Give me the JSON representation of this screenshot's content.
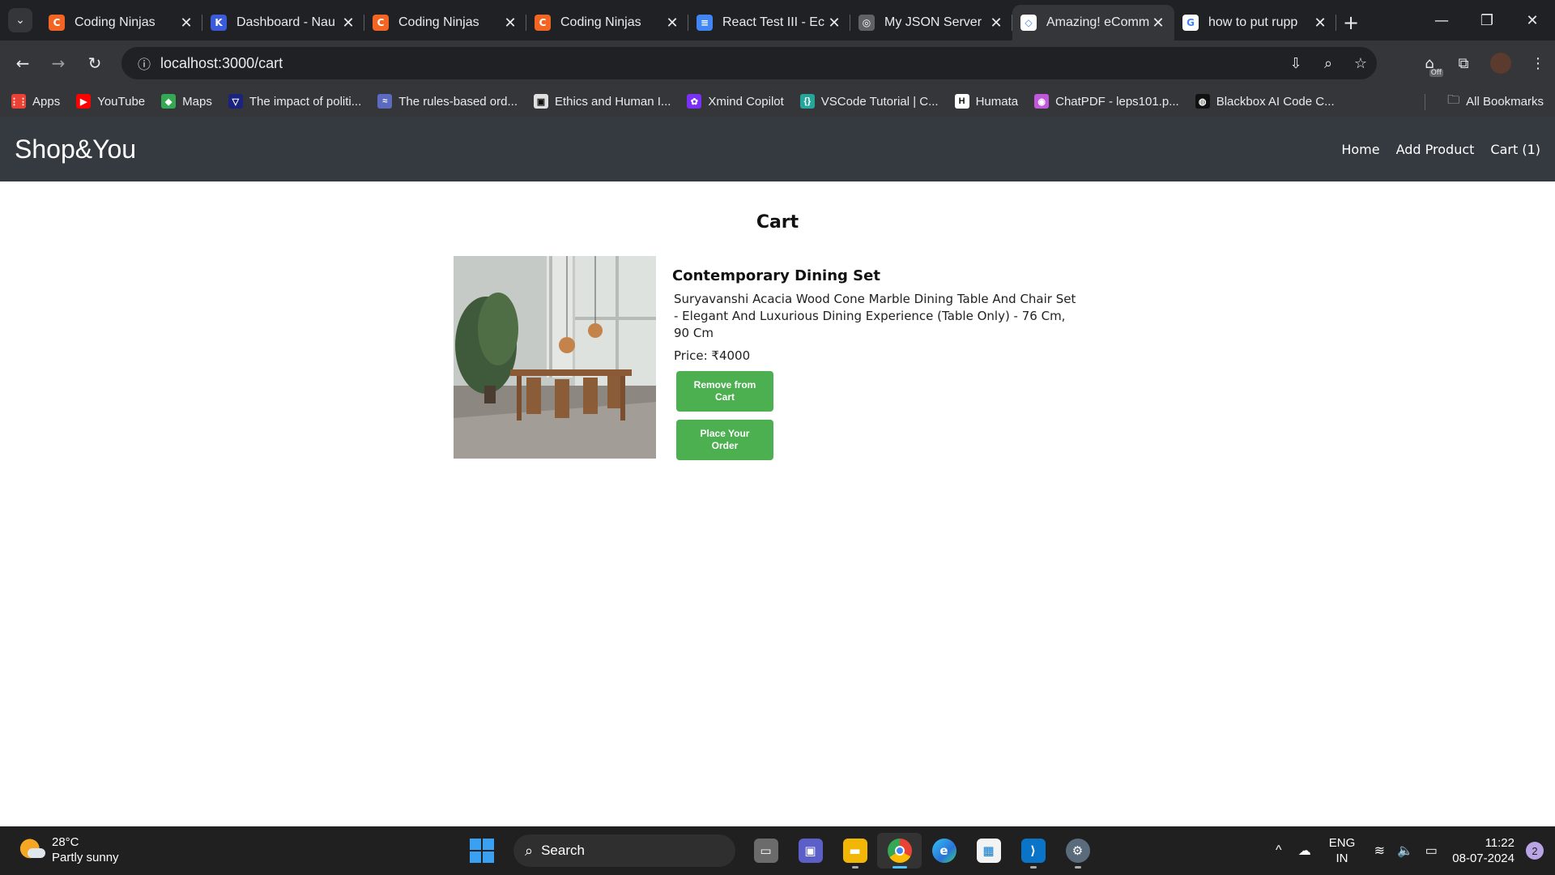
{
  "browser": {
    "tabs": [
      {
        "title": "Coding Ninjas",
        "favicon_color": "#f26522",
        "favicon_glyph": "C",
        "active": false
      },
      {
        "title": "Dashboard - Nau",
        "favicon_color": "#3b5bdb",
        "favicon_glyph": "K",
        "active": false
      },
      {
        "title": "Coding Ninjas",
        "favicon_color": "#f26522",
        "favicon_glyph": "C",
        "active": false
      },
      {
        "title": "Coding Ninjas",
        "favicon_color": "#f26522",
        "favicon_glyph": "C",
        "active": false
      },
      {
        "title": "React Test III - Ec",
        "favicon_color": "#4285f4",
        "favicon_glyph": "≡",
        "active": false
      },
      {
        "title": "My JSON Server",
        "favicon_color": "#5f6368",
        "favicon_glyph": "◎",
        "active": false
      },
      {
        "title": "Amazing! eComm",
        "favicon_color": "#ffffff",
        "favicon_glyph": "◇",
        "active": true
      },
      {
        "title": "how to put rupp",
        "favicon_color": "#ffffff",
        "favicon_glyph": "G",
        "active": false
      }
    ],
    "url": "localhost:3000/cart",
    "extension_badge": "Off",
    "bookmarks": [
      {
        "label": "Apps",
        "icon_color": "#ea4335",
        "glyph": "⋮⋮"
      },
      {
        "label": "YouTube",
        "icon_color": "#ff0000",
        "glyph": "▶"
      },
      {
        "label": "Maps",
        "icon_color": "#34a853",
        "glyph": "◆"
      },
      {
        "label": "The impact of politi...",
        "icon_color": "#1a237e",
        "glyph": "▽"
      },
      {
        "label": "The rules-based ord...",
        "icon_color": "#5c6bc0",
        "glyph": "≈"
      },
      {
        "label": "Ethics and Human I...",
        "icon_color": "#e0e0e0",
        "glyph": "▣"
      },
      {
        "label": "Xmind Copilot",
        "icon_color": "#7b2ff7",
        "glyph": "✿"
      },
      {
        "label": "VSCode Tutorial | C...",
        "icon_color": "#26a69a",
        "glyph": "{}"
      },
      {
        "label": "Humata",
        "icon_color": "#ffffff",
        "glyph": "H"
      },
      {
        "label": "ChatPDF - leps101.p...",
        "icon_color": "#c158dc",
        "glyph": "◉"
      },
      {
        "label": "Blackbox AI Code C...",
        "icon_color": "#111111",
        "glyph": "◍"
      }
    ],
    "all_bookmarks": "All Bookmarks"
  },
  "app": {
    "brand": "Shop&You",
    "nav": [
      "Home",
      "Add Product",
      "Cart (1)"
    ],
    "page_title": "Cart",
    "cart_items": [
      {
        "name": "Contemporary Dining Set",
        "description": "Suryavanshi Acacia Wood Cone Marble Dining Table And Chair Set - Elegant And Luxurious Dining Experience (Table Only) - 76 Cm, 90 Cm",
        "price": "Price: ₹4000",
        "remove_label": "Remove from Cart",
        "order_label": "Place Your Order"
      }
    ]
  },
  "taskbar": {
    "weather_temp": "28°C",
    "weather_desc": "Partly sunny",
    "search_label": "Search",
    "lang_line1": "ENG",
    "lang_line2": "IN",
    "time": "11:22",
    "date": "08-07-2024",
    "notification_count": "2"
  },
  "colors": {
    "navbar_bg": "#343a40",
    "button_green": "#4caf50",
    "chrome_dark": "#202124",
    "chrome_toolbar": "#35363a"
  }
}
